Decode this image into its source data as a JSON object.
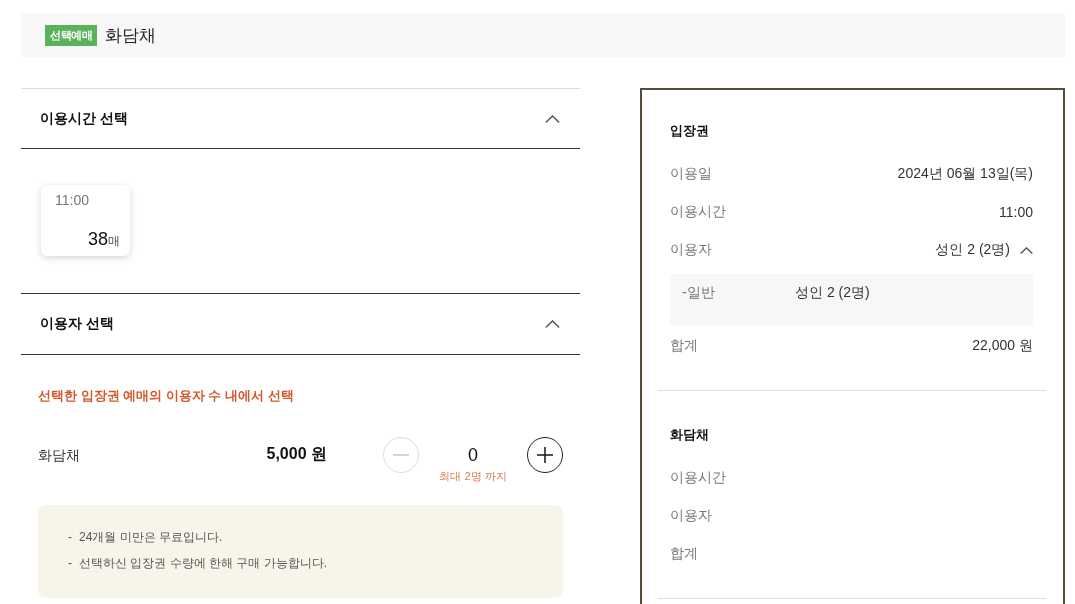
{
  "header": {
    "badge": "선택예매",
    "title": "화담채"
  },
  "sections": [
    {
      "kind": "times",
      "title": "이용시간 선택",
      "expanded": true,
      "slots": [
        {
          "time": "11:00",
          "count": "38",
          "unit": "매",
          "selected": false
        }
      ]
    },
    {
      "kind": "users",
      "title": "이용자 선택",
      "expanded": true,
      "notice": "선택한 입장권 예매의 이용자 수 내에서 선택",
      "items": [
        {
          "name": "화담채",
          "price": "5,000 원",
          "quantity": "0",
          "limit": "최대 2명 까지",
          "decrement": {
            "disabled": true
          },
          "increment": {
            "disabled": false
          }
        }
      ],
      "notes": [
        {
          "bullet": "-",
          "text": "24개월 미만은 무료입니다."
        },
        {
          "bullet": "-",
          "text": "선택하신 입장권 수량에 한해 구매 가능합니다."
        }
      ]
    }
  ],
  "summary": [
    {
      "title": "입장권",
      "rows": [
        {
          "label": "이용일",
          "value": "2024년 06월 13일(목)"
        },
        {
          "label": "이용시간",
          "value": "11:00"
        },
        {
          "label": "이용자",
          "value": "성인 2 (2명)",
          "expanded": true,
          "details": [
            {
              "label": "-일반",
              "value": "성인 2 (2명)"
            }
          ]
        },
        {
          "label": "합계",
          "value": "22,000 원"
        }
      ]
    },
    {
      "title": "화담채",
      "rows": [
        {
          "label": "이용시간"
        },
        {
          "label": "이용자"
        },
        {
          "label": "합계"
        }
      ]
    }
  ]
}
